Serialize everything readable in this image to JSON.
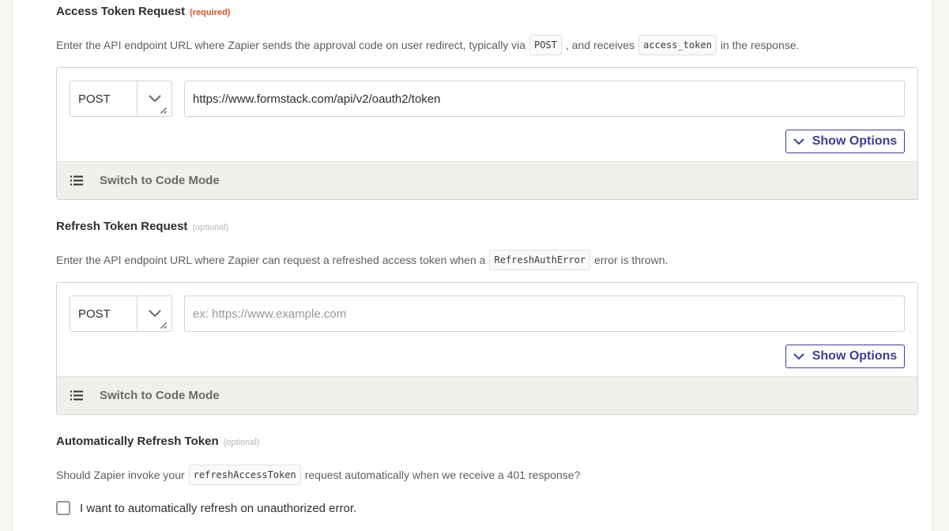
{
  "access": {
    "title": "Access Token Request",
    "tag": "(required)",
    "desc_before": "Enter the API endpoint URL where Zapier sends the approval code on user redirect, typically via",
    "code1": "POST",
    "desc_middle": ", and receives",
    "code2": "access_token",
    "desc_after": "in the response.",
    "method": "POST",
    "url_value": "https://www.formstack.com/api/v2/oauth2/token",
    "show_options": "Show Options",
    "code_mode": "Switch to Code Mode"
  },
  "refresh": {
    "title": "Refresh Token Request",
    "tag": "(optional)",
    "desc_before": "Enter the API endpoint URL where Zapier can request a refreshed access token when a",
    "code1": "RefreshAuthError",
    "desc_after": "error is thrown.",
    "method": "POST",
    "url_placeholder": "ex: https://www.example.com",
    "show_options": "Show Options",
    "code_mode": "Switch to Code Mode"
  },
  "auto_refresh": {
    "title": "Automatically Refresh Token",
    "tag": "(optional)",
    "desc_before": "Should Zapier invoke your",
    "code1": "refreshAccessToken",
    "desc_after": "request automatically when we receive a 401 response?",
    "checkbox_label": "I want to automatically refresh on unauthorized error.",
    "checked": false
  },
  "icons": {
    "method_caret": "chevron-down-icon",
    "show_options": "chevron-down-icon",
    "code_mode": "list-icon"
  },
  "colors": {
    "accent": "#3b3f8f",
    "required": "#d9532a",
    "optional": "#b8b6b0"
  }
}
